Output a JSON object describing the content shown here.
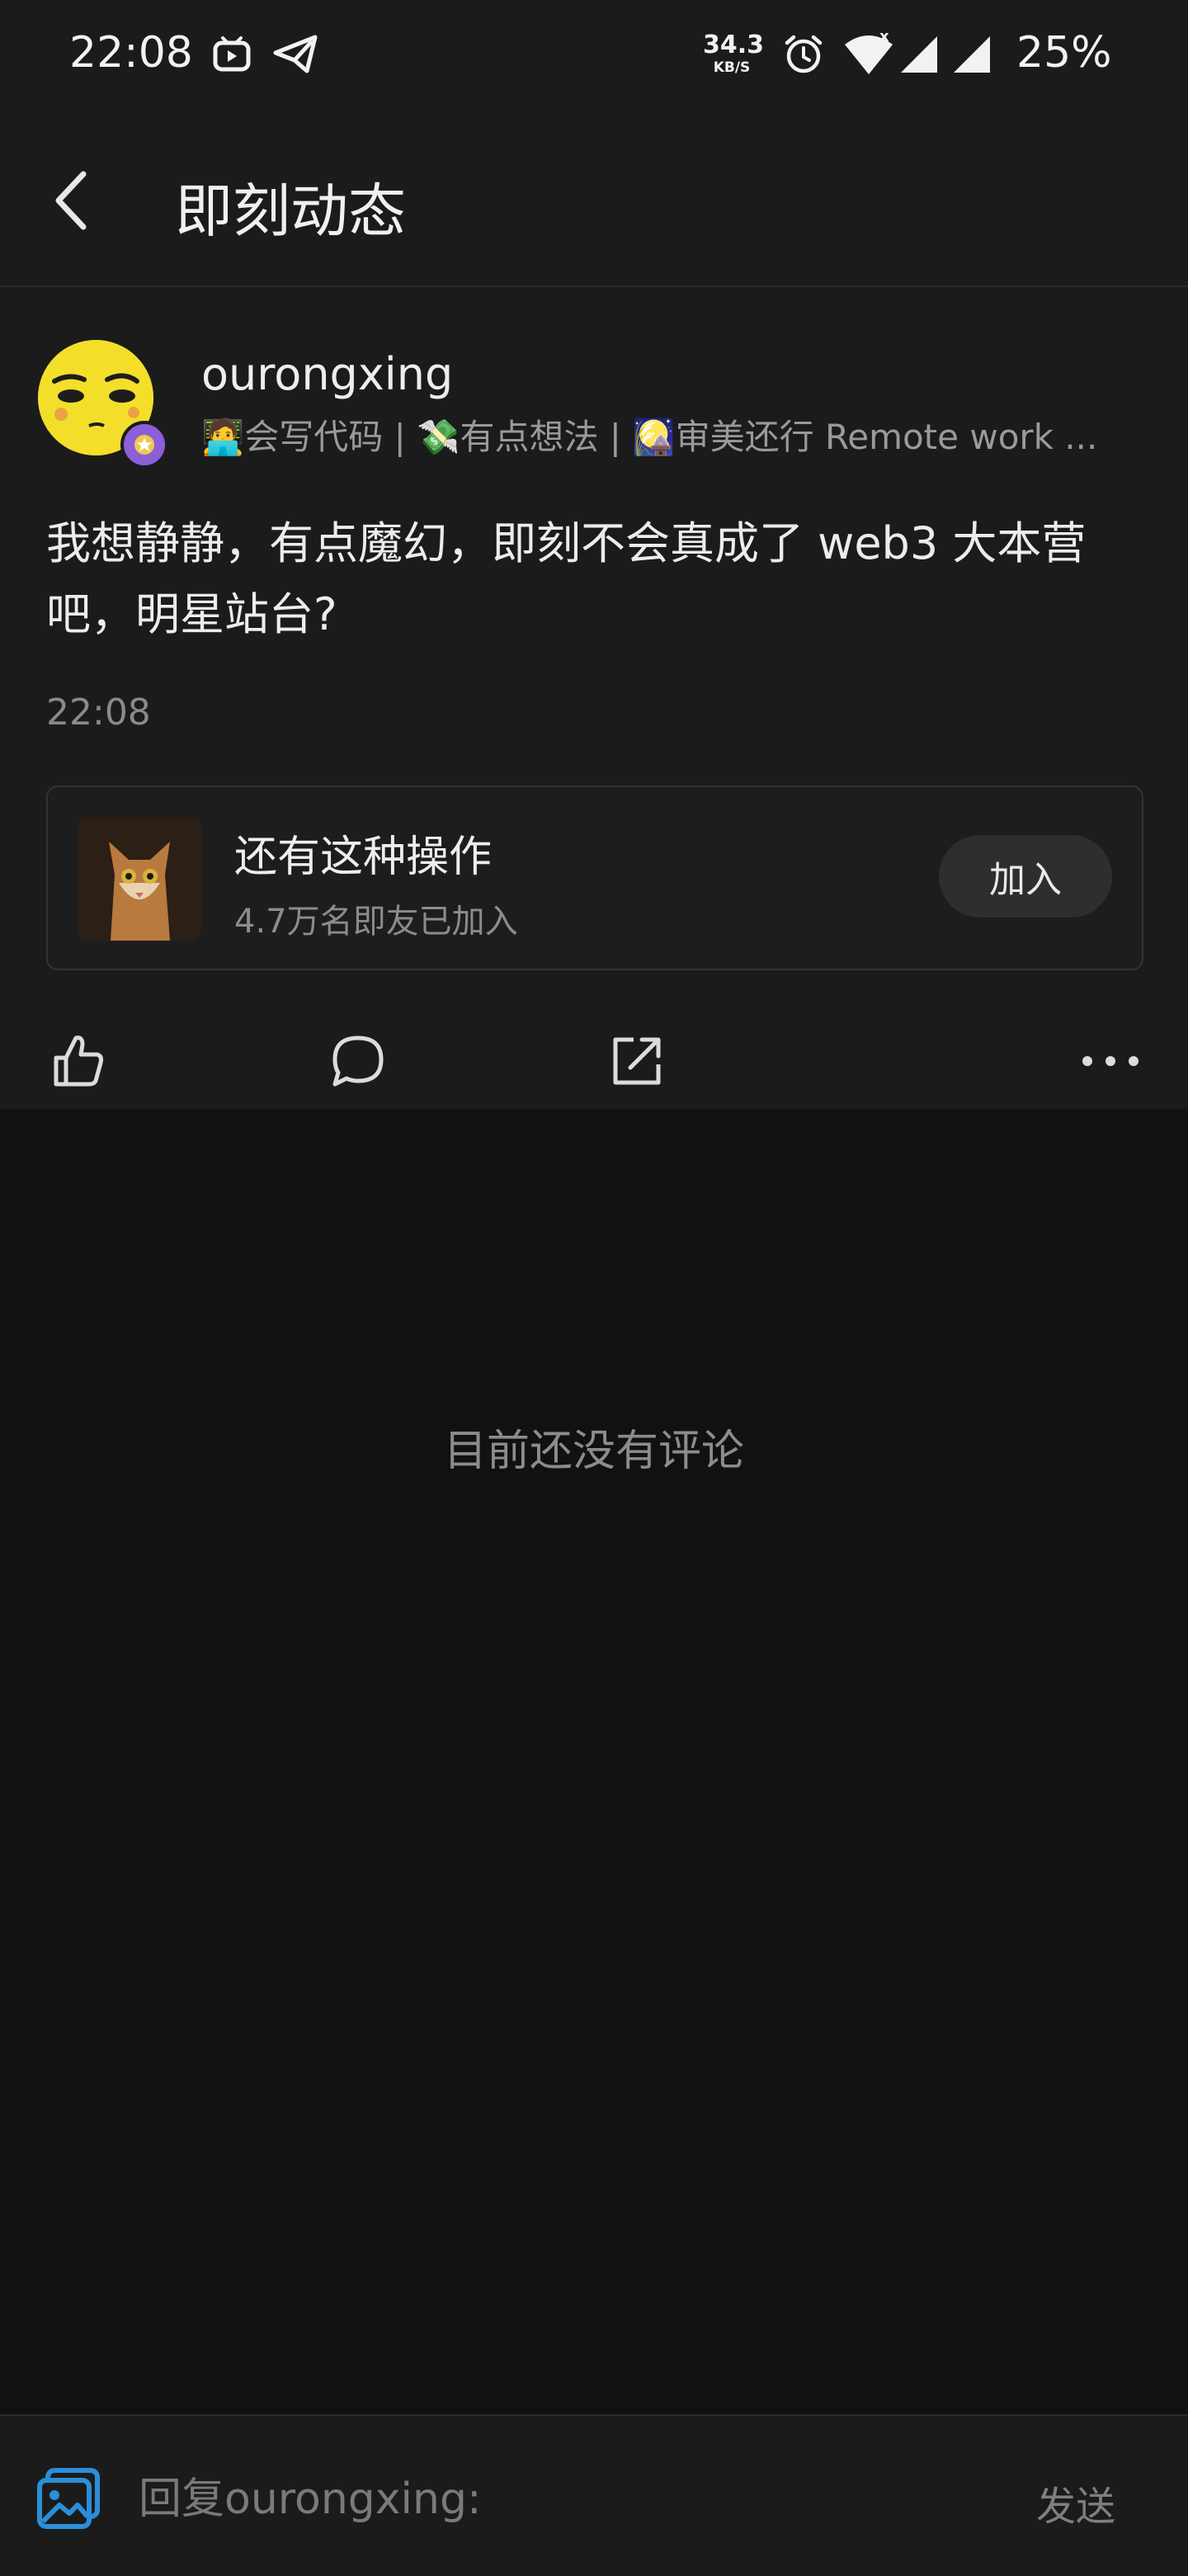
{
  "status_bar": {
    "time": "22:08",
    "net_speed_value": "34.3",
    "net_speed_unit": "KB/S",
    "battery": "25%"
  },
  "header": {
    "title": "即刻动态"
  },
  "post": {
    "username": "ourongxing",
    "bio": "🧑‍💻会写代码 | 💸有点想法 | 🎑审美还行  Remote work ...",
    "content": "我想静静，有点魔幻，即刻不会真成了 web3 大本营吧，明星站台?",
    "time": "22:08",
    "circle": {
      "name": "还有这种操作",
      "members": "4.7万名即友已加入",
      "join_label": "加入"
    }
  },
  "comments": {
    "empty_text": "目前还没有评论"
  },
  "reply": {
    "placeholder": "回复ourongxing:",
    "send_label": "发送"
  },
  "colors": {
    "background": "#111111",
    "surface": "#1b1b1b",
    "accent": "#2a8fd8"
  }
}
